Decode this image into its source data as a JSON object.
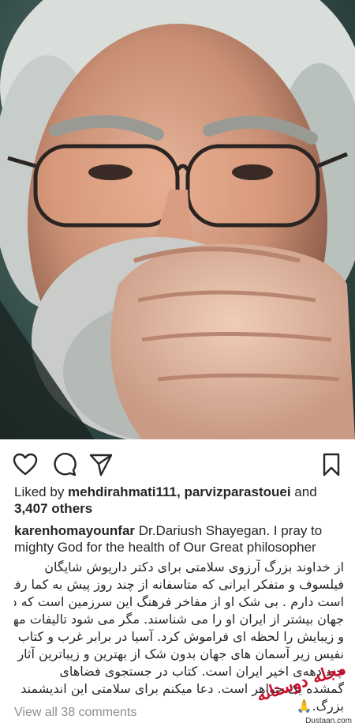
{
  "post": {
    "likes_prefix": "Liked by ",
    "likes_users": "mehdirahmati111, parvizparastouei",
    "likes_and": " and ",
    "likes_count": "3,407 others",
    "caption_user": "karenhomayounfar",
    "caption_en": " Dr.Dariush Shayegan. I pray to mighty God for the health of Our Great philosopher",
    "caption_fa_lines": [
      "از خداوند بزرگ آرزوی سلامتی برای دکتر داریوش شایگان",
      "فیلسوف و متفکر ایرانی که متاسفانه از چند روز پیش به کما رفته",
      "است دارم . بی شک او از مفاخر فرهنگ این سرزمین است که در",
      "جهان بیشتر از ایران او را می شناسند. مگر می شود تالیفات مهم",
      "و زیبایش را لحظه ای فراموش کرد. آسیا در برابر غرب و کتاب",
      "نفیس زیر آسمان های جهان بدون شک از بهترین و زیباترین آثار",
      "چند دهه‌ی اخیر ایران است. کتاب در جستجوی فضاهای",
      "گمشده یک جواهر است. دعا میکنم برای سلامتی این اندیشمند",
      "بزرگ.🙏"
    ],
    "view_comments": "View all 38 comments"
  },
  "icons": {
    "like": "heart-icon",
    "comment": "comment-icon",
    "share": "paper-plane-icon",
    "save": "bookmark-icon"
  },
  "watermark": {
    "logo_text": "مجله دوستانه",
    "site": "Dustaan.com"
  },
  "colors": {
    "text": "#262626",
    "muted": "#8e8e8e",
    "watermark_red": "#c8102e"
  }
}
